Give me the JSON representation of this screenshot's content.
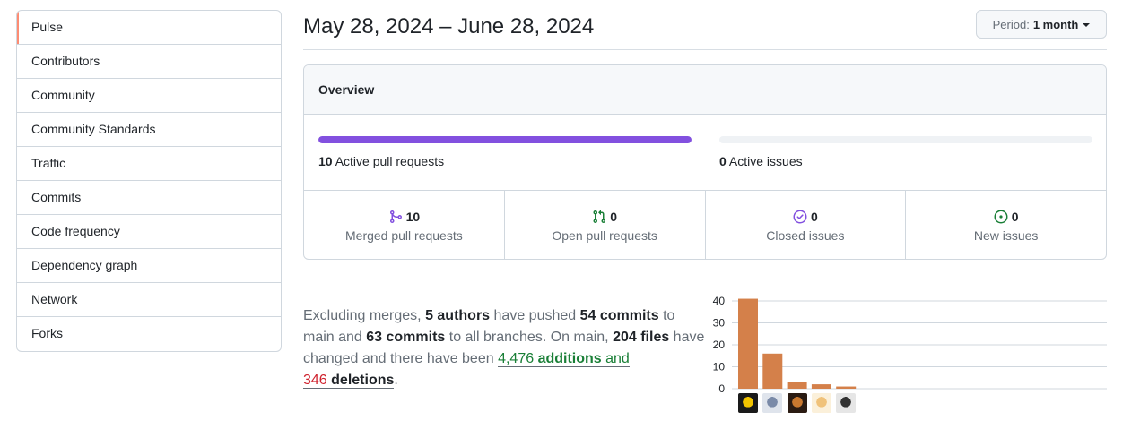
{
  "sidebar": {
    "items": [
      {
        "label": "Pulse",
        "selected": true
      },
      {
        "label": "Contributors"
      },
      {
        "label": "Community"
      },
      {
        "label": "Community Standards"
      },
      {
        "label": "Traffic"
      },
      {
        "label": "Commits"
      },
      {
        "label": "Code frequency"
      },
      {
        "label": "Dependency graph"
      },
      {
        "label": "Network"
      },
      {
        "label": "Forks"
      }
    ]
  },
  "header": {
    "date_range": "May 28, 2024 – June 28, 2024",
    "period_prefix": "Period:",
    "period_value": "1 month"
  },
  "overview": {
    "title": "Overview",
    "pull_requests": {
      "count": "10",
      "label": "Active pull requests",
      "fill_fraction": 1.0,
      "color": "#8250df"
    },
    "issues": {
      "count": "0",
      "label": "Active issues",
      "fill_fraction": 0.0
    },
    "stats": [
      {
        "icon": "git-merge-icon",
        "count": "10",
        "label": "Merged pull requests",
        "color": "#8250df"
      },
      {
        "icon": "git-pull-request-icon",
        "count": "0",
        "label": "Open pull requests",
        "color": "#1a7f37"
      },
      {
        "icon": "issue-closed-icon",
        "count": "0",
        "label": "Closed issues",
        "color": "#8250df"
      },
      {
        "icon": "issue-opened-icon",
        "count": "0",
        "label": "New issues",
        "color": "#1a7f37"
      }
    ]
  },
  "summary": {
    "t1": "Excluding merges, ",
    "authors": "5 authors",
    "t2": " have pushed ",
    "commits_main": "54 commits",
    "t3": " to main and ",
    "commits_all": "63 commits",
    "t4": " to all branches. On main, ",
    "files": "204 files",
    "t5": " have changed and there have been ",
    "additions_num": "4,476",
    "additions_word": "additions",
    "t6": " and",
    "deletions_num": "346",
    "deletions_word": "deletions",
    "t7": "."
  },
  "chart_data": {
    "type": "bar",
    "categories": [
      "author1",
      "author2",
      "author3",
      "author4",
      "author5"
    ],
    "values": [
      41,
      16,
      3,
      2,
      1
    ],
    "ylim": [
      0,
      40
    ],
    "yticks": [
      "40",
      "30",
      "20",
      "10",
      "0"
    ],
    "bar_color": "#d4804a",
    "grid": true
  }
}
